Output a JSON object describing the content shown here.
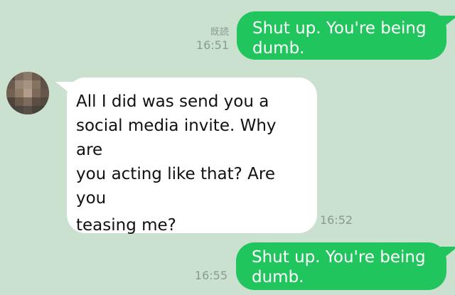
{
  "messages": [
    {
      "direction": "outgoing",
      "text_line_1": "Shut up. You're being",
      "text_line_2": "dumb.",
      "read_receipt": "既読",
      "time": "16:51"
    },
    {
      "direction": "incoming",
      "text_lines": [
        "All I did was send you a",
        "social media invite. Why are",
        "you acting like that? Are you",
        "teasing me?"
      ],
      "time": "16:52",
      "avatar": "blurred-profile-photo"
    },
    {
      "direction": "outgoing",
      "text_line_1": "Shut up. You're being",
      "text_line_2": "dumb.",
      "time": "16:55"
    }
  ],
  "colors": {
    "background": "#cbe1d0",
    "outgoing_bubble": "#21c55d",
    "incoming_bubble": "#ffffff",
    "meta_text": "#8a9a8e"
  },
  "avatar_mosaic": [
    "#5c4f45",
    "#7a6a5c",
    "#8c7b6b",
    "#6d5d50",
    "#584b42",
    "#6b5a4d",
    "#9a8677",
    "#a89383",
    "#857261",
    "#5f5147",
    "#73624f",
    "#8f7a67",
    "#b29c8b",
    "#7c6959",
    "#66574b",
    "#4f443d",
    "#6a5a4c",
    "#7d6b5b",
    "#5b4d43",
    "#54483f",
    "#44403b",
    "#4c4640",
    "#5a4f47",
    "#48423c",
    "#3f3b37"
  ]
}
